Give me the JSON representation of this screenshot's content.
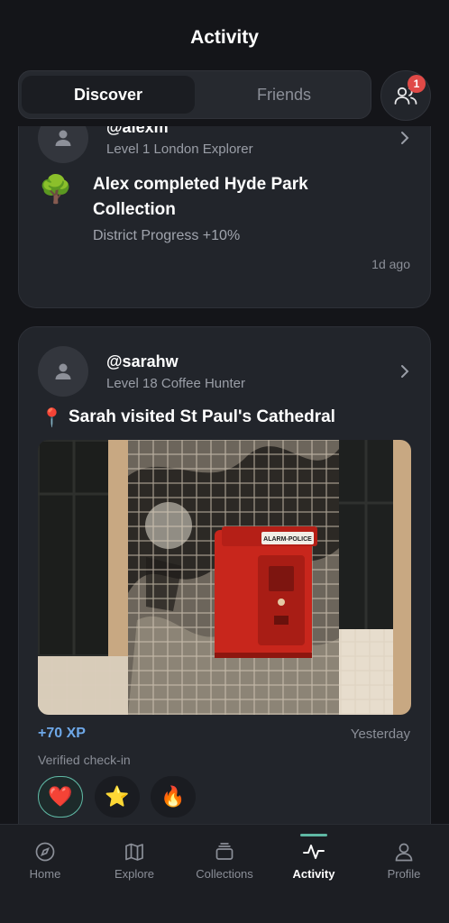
{
  "header": {
    "title": "Activity"
  },
  "segment": {
    "tabs": [
      {
        "label": "Discover",
        "active": true
      },
      {
        "label": "Friends",
        "active": false
      }
    ]
  },
  "friends_button": {
    "badge": "1"
  },
  "feed": [
    {
      "username": "@alexm",
      "level": "Level 1 London Explorer",
      "emoji": "🌳",
      "title": "Alex completed Hyde Park Collection",
      "subtitle": "District Progress +10%",
      "time": "1d ago"
    },
    {
      "username": "@sarahw",
      "level": "Level 18 Coffee Hunter",
      "emoji": "📍",
      "title": "Sarah visited St Paul's Cathedral",
      "photo_label": "ALARM-POLICE",
      "xp": "+70 XP",
      "time": "Yesterday",
      "verified": "Verified check-in",
      "reactions": [
        {
          "emoji": "❤️",
          "selected": true
        },
        {
          "emoji": "⭐",
          "selected": false
        },
        {
          "emoji": "🔥",
          "selected": false
        }
      ]
    }
  ],
  "tabbar": {
    "items": [
      {
        "label": "Home",
        "icon": "compass-icon"
      },
      {
        "label": "Explore",
        "icon": "map-icon"
      },
      {
        "label": "Collections",
        "icon": "collections-icon"
      },
      {
        "label": "Activity",
        "icon": "activity-icon",
        "active": true
      },
      {
        "label": "Profile",
        "icon": "profile-icon"
      }
    ]
  },
  "colors": {
    "background": "#141519",
    "card": "#22252b",
    "accent": "#5fb8a4",
    "xp": "#6ea8e8",
    "badge": "#e04a47"
  }
}
